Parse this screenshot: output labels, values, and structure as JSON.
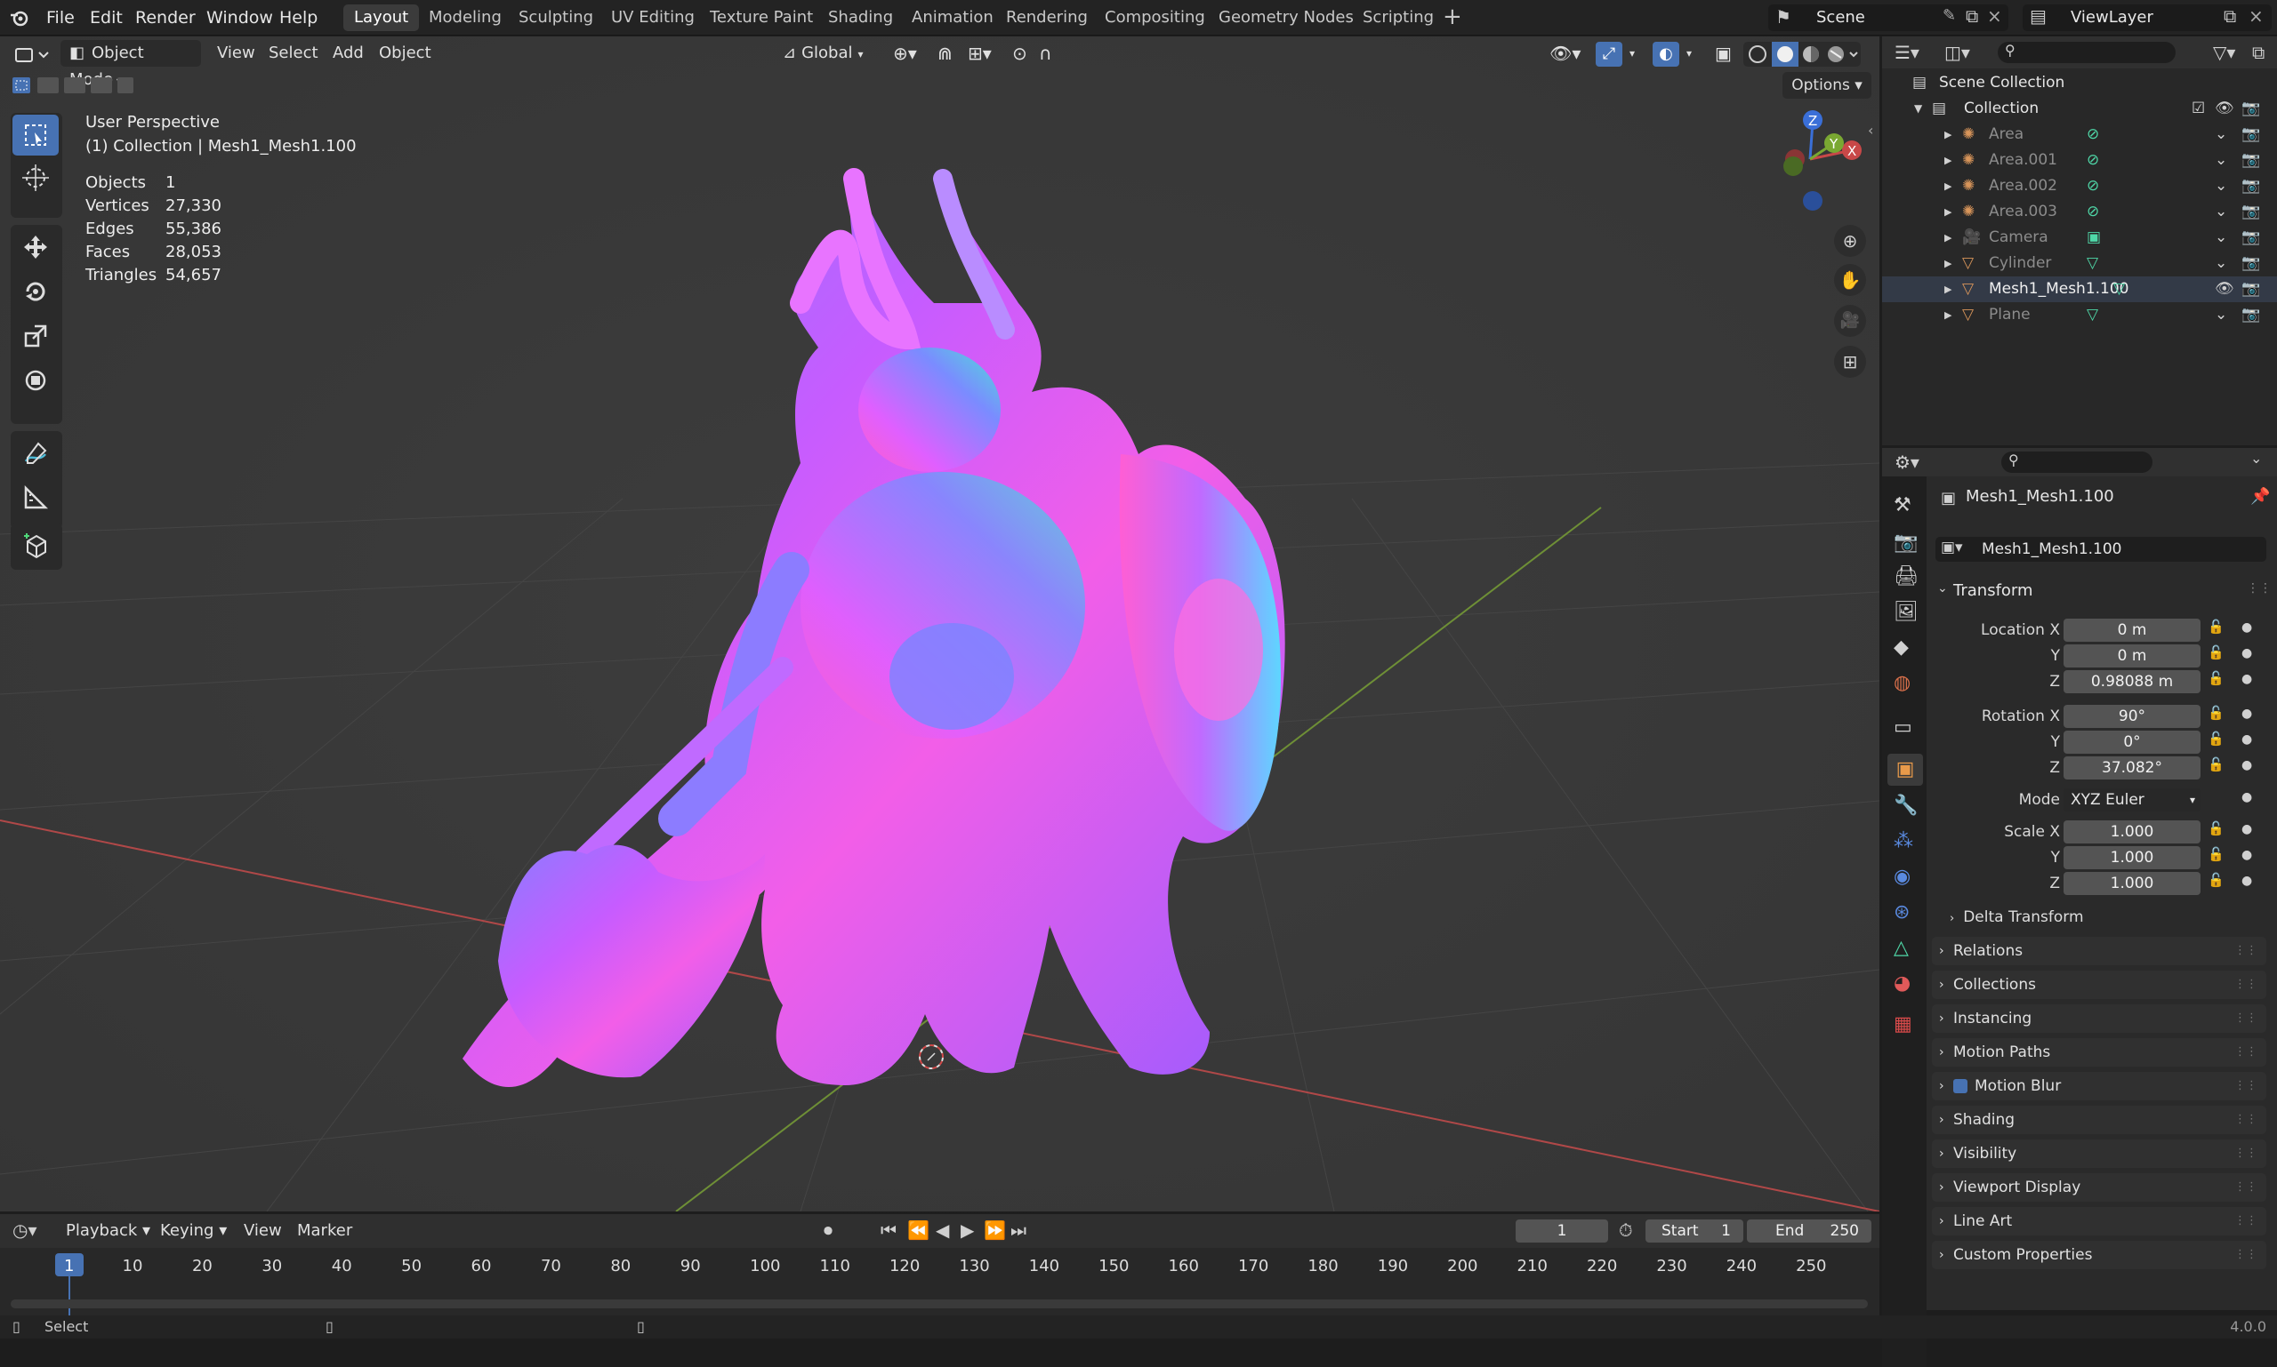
{
  "topbar": {
    "menus": [
      "File",
      "Edit",
      "Render",
      "Window",
      "Help"
    ],
    "workspaces": [
      "Layout",
      "Modeling",
      "Sculpting",
      "UV Editing",
      "Texture Paint",
      "Shading",
      "Animation",
      "Rendering",
      "Compositing",
      "Geometry Nodes",
      "Scripting"
    ],
    "active_workspace": "Layout",
    "scene": "Scene",
    "view_layer": "ViewLayer"
  },
  "viewport_header": {
    "mode": "Object Mode",
    "menus": [
      "View",
      "Select",
      "Add",
      "Object"
    ],
    "transform_orientation": "Global",
    "options_label": "Options"
  },
  "overlay": {
    "view_name": "User Perspective",
    "collection_line": "(1) Collection | Mesh1_Mesh1.100",
    "stats": [
      {
        "label": "Objects",
        "value": "1"
      },
      {
        "label": "Vertices",
        "value": "27,330"
      },
      {
        "label": "Edges",
        "value": "55,386"
      },
      {
        "label": "Faces",
        "value": "28,053"
      },
      {
        "label": "Triangles",
        "value": "54,657"
      }
    ]
  },
  "gizmo": {
    "x": "X",
    "y": "Y",
    "z": "Z"
  },
  "outliner": {
    "root": "Scene Collection",
    "collection": "Collection",
    "items": [
      {
        "name": "Area",
        "icon": "light-icon",
        "active": false
      },
      {
        "name": "Area.001",
        "icon": "light-icon",
        "active": false
      },
      {
        "name": "Area.002",
        "icon": "light-icon",
        "active": false
      },
      {
        "name": "Area.003",
        "icon": "light-icon",
        "active": false
      },
      {
        "name": "Camera",
        "icon": "camera-icon",
        "active": false
      },
      {
        "name": "Cylinder",
        "icon": "mesh-icon",
        "active": false
      },
      {
        "name": "Mesh1_Mesh1.100",
        "icon": "mesh-icon",
        "active": true
      },
      {
        "name": "Plane",
        "icon": "mesh-icon",
        "active": false
      }
    ]
  },
  "properties": {
    "object_title": "Mesh1_Mesh1.100",
    "object_name_field": "Mesh1_Mesh1.100",
    "transform_label": "Transform",
    "location": {
      "label": "Location X",
      "x": "0 m",
      "y": "0 m",
      "z": "0.98088 m"
    },
    "rotation": {
      "label": "Rotation X",
      "x": "90°",
      "y": "0°",
      "z": "37.082°"
    },
    "mode_label": "Mode",
    "mode_value": "XYZ Euler",
    "scale": {
      "label": "Scale X",
      "x": "1.000",
      "y": "1.000",
      "z": "1.000"
    },
    "axis_y": "Y",
    "axis_z": "Z",
    "delta_transform": "Delta Transform",
    "panels": [
      "Relations",
      "Collections",
      "Instancing",
      "Motion Paths",
      "Motion Blur",
      "Shading",
      "Visibility",
      "Viewport Display",
      "Line Art",
      "Custom Properties"
    ]
  },
  "timeline": {
    "menus": [
      "Playback",
      "Keying",
      "View",
      "Marker"
    ],
    "current_frame": "1",
    "start_label": "Start",
    "start_value": "1",
    "end_label": "End",
    "end_value": "250",
    "ticks": [
      "1",
      "10",
      "20",
      "30",
      "40",
      "50",
      "60",
      "70",
      "80",
      "90",
      "100",
      "110",
      "120",
      "130",
      "140",
      "150",
      "160",
      "170",
      "180",
      "190",
      "200",
      "210",
      "220",
      "230",
      "240",
      "250"
    ]
  },
  "statusbar": {
    "left": "Select",
    "version": "4.0.0"
  },
  "colors": {
    "accent": "#4772b3",
    "x_axis": "#c84848",
    "y_axis": "#7aa832",
    "z_axis": "#3a6fd8"
  }
}
